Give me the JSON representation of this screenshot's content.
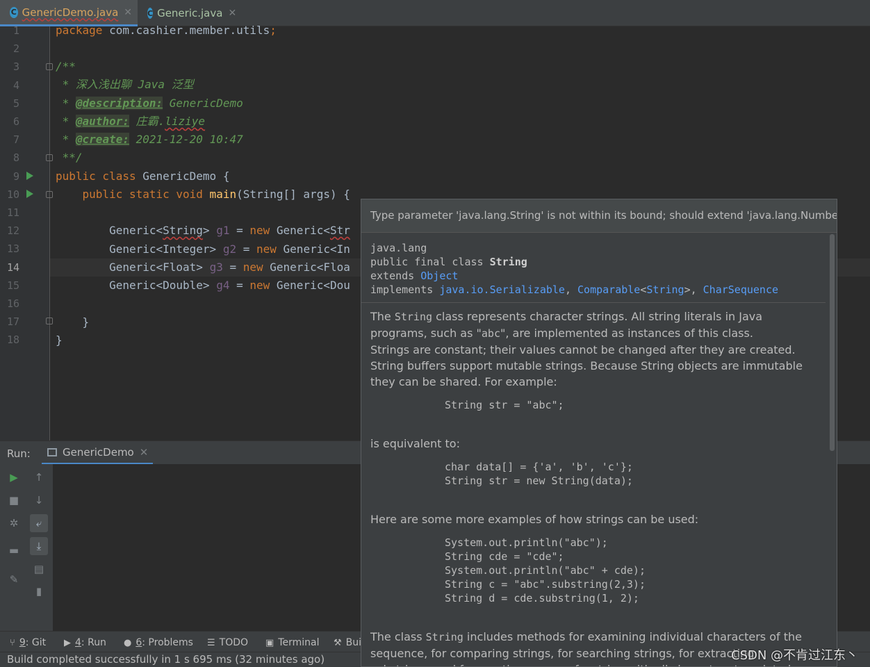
{
  "tabs": [
    {
      "label": "GenericDemo.java",
      "icon": "java-class-icon",
      "active": true
    },
    {
      "label": "Generic.java",
      "icon": "java-class-icon",
      "active": false
    }
  ],
  "editor": {
    "line_numbers": [
      "1",
      "2",
      "3",
      "4",
      "5",
      "6",
      "7",
      "8",
      "9",
      "10",
      "11",
      "12",
      "13",
      "14",
      "15",
      "16",
      "17",
      "18"
    ],
    "current_line": "14",
    "lines": {
      "l1": {
        "kw": "package",
        "rest": " com.cashier.member.utils",
        "semi": ";"
      },
      "l3": "/**",
      "l4": " * 深入浅出聊 Java 泛型",
      "l5": {
        "star": " * ",
        "tag": "@description:",
        "text": " GenericDemo"
      },
      "l6": {
        "star": " * ",
        "tag": "@author:",
        "text1": " 庄霸.",
        "text2": "liziye"
      },
      "l7": {
        "star": " * ",
        "tag": "@create:",
        "text": " 2021-12-20 10:47"
      },
      "l8": " **/",
      "l9": {
        "kw": "public class",
        "rest": " GenericDemo {"
      },
      "l10": {
        "kw": "    public static void",
        "fn": " main",
        "rest": "(String[] args) {"
      },
      "l12": {
        "a": "        Generic<",
        "b": "String",
        "c": "> ",
        "v": "g1",
        "d": " = ",
        "kw": "new",
        "e": " Generic<",
        "f": "Str"
      },
      "l13": {
        "a": "        Generic<Integer> ",
        "v": "g2",
        "d": " = ",
        "kw": "new",
        "e": " Generic<In"
      },
      "l14": {
        "a": "        Generic<Float> ",
        "v": "g3",
        "d": " = ",
        "kw": "new",
        "e": " Generic<Floa"
      },
      "l15": {
        "a": "        Generic<Double> ",
        "v": "g4",
        "d": " = ",
        "kw": "new",
        "e": " Generic<Dou"
      },
      "l17": "    }",
      "l18": "}"
    }
  },
  "popup": {
    "error": "Type parameter 'java.lang.String' is not within its bound; should extend 'java.lang.Number'",
    "decl": {
      "package": "java.lang",
      "prefix": "public final class ",
      "class_name": "String",
      "extends_kw": "extends ",
      "extends_link": "Object",
      "implements_kw": "implements ",
      "impl1": "java.io.Serializable",
      "comma1": ", ",
      "impl2a": "Comparable",
      "lt": "<",
      "impl2b": "String",
      "gt": ">",
      "comma2": ", ",
      "impl3": "CharSequence"
    },
    "p1a": "The ",
    "p1code": "String",
    "p1b": " class represents character strings. All string literals in Java programs, such as \"",
    "p1code2": "abc",
    "p1c": "\", are implemented as instances of this class.",
    "p2": "Strings are constant; their values cannot be changed after they are created. String buffers support mutable strings. Because String objects are immutable they can be shared. For example:",
    "code1": "String str = \"abc\";",
    "p3": "is equivalent to:",
    "code2": "char data[] = {'a', 'b', 'c'};\nString str = new String(data);",
    "p4": "Here are some more examples of how strings can be used:",
    "code3": "System.out.println(\"abc\");\nString cde = \"cde\";\nSystem.out.println(\"abc\" + cde);\nString c = \"abc\".substring(2,3);\nString d = cde.substring(1, 2);",
    "p5a": "The class ",
    "p5code": "String",
    "p5b": " includes methods for examining individual characters of the sequence, for comparing strings, for searching strings, for extracting substrings, and for creating a copy of a string with all characters translated"
  },
  "run_panel": {
    "label": "Run:",
    "tab": "GenericDemo"
  },
  "toolwindows": [
    {
      "num": "9",
      "label": ": Git",
      "icon": "git-icon"
    },
    {
      "num": "4",
      "label": ": Run",
      "icon": "run-icon"
    },
    {
      "num": "6",
      "label": ": Problems",
      "icon": "problems-icon"
    },
    {
      "num": "",
      "label": "TODO",
      "icon": "todo-icon"
    },
    {
      "num": "",
      "label": "Terminal",
      "icon": "terminal-icon"
    },
    {
      "num": "",
      "label": "Bui",
      "icon": "build-icon"
    }
  ],
  "status": "Build completed successfully in 1 s 695 ms (32 minutes ago)",
  "watermark": "CSDN @不肯过江东丶",
  "colors": {
    "keyword": "#cc7832",
    "comment": "#629755",
    "link": "#589df6",
    "accent": "#4a88c7",
    "run": "#499c54"
  }
}
